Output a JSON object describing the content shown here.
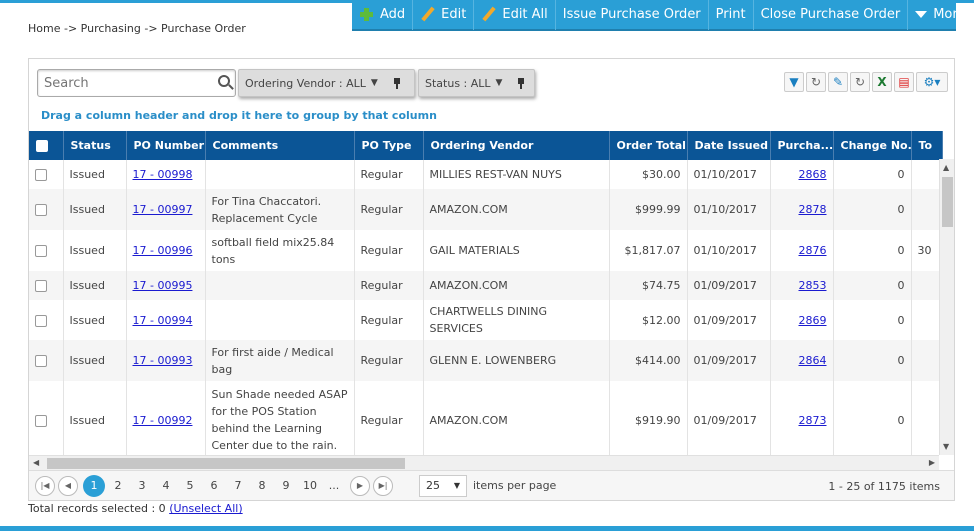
{
  "breadcrumb": "Home -> Purchasing -> Purchase Order",
  "toolbar": {
    "add": "Add",
    "edit": "Edit",
    "edit_all": "Edit All",
    "issue_po": "Issue Purchase Order",
    "print": "Print",
    "close_po": "Close Purchase Order",
    "more": "More"
  },
  "search": {
    "placeholder": "Search"
  },
  "filters": {
    "vendor": "Ordering Vendor : ALL",
    "status": "Status : ALL"
  },
  "group_hint": "Drag a column header and drop it here to group by that column",
  "columns": [
    "Status",
    "PO Number",
    "Comments",
    "PO Type",
    "Ordering Vendor",
    "Order Total",
    "Date Issued",
    "Purcha...",
    "Change No.",
    "To"
  ],
  "rows": [
    {
      "status": "Issued",
      "po": "17 - 00998",
      "comments": "",
      "type": "Regular",
      "vendor": "MILLIES REST-VAN NUYS",
      "total": "$30.00",
      "date": "01/10/2017",
      "req": "2868",
      "change": "0",
      "to": ""
    },
    {
      "status": "Issued",
      "po": "17 - 00997",
      "comments": "For Tina Chaccatori. Replacement Cycle",
      "type": "Regular",
      "vendor": "AMAZON.COM",
      "total": "$999.99",
      "date": "01/10/2017",
      "req": "2878",
      "change": "0",
      "to": ""
    },
    {
      "status": "Issued",
      "po": "17 - 00996",
      "comments": "softball field mix25.84 tons",
      "type": "Regular",
      "vendor": "GAIL MATERIALS",
      "total": "$1,817.07",
      "date": "01/10/2017",
      "req": "2876",
      "change": "0",
      "to": "30"
    },
    {
      "status": "Issued",
      "po": "17 - 00995",
      "comments": "",
      "type": "Regular",
      "vendor": "AMAZON.COM",
      "total": "$74.75",
      "date": "01/09/2017",
      "req": "2853",
      "change": "0",
      "to": ""
    },
    {
      "status": "Issued",
      "po": "17 - 00994",
      "comments": "",
      "type": "Regular",
      "vendor": "CHARTWELLS DINING SERVICES",
      "total": "$12.00",
      "date": "01/09/2017",
      "req": "2869",
      "change": "0",
      "to": ""
    },
    {
      "status": "Issued",
      "po": "17 - 00993",
      "comments": "For first aide / Medical bag",
      "type": "Regular",
      "vendor": "GLENN E. LOWENBERG",
      "total": "$414.00",
      "date": "01/09/2017",
      "req": "2864",
      "change": "0",
      "to": ""
    },
    {
      "status": "Issued",
      "po": "17 - 00992",
      "comments": "Sun Shade needed ASAP for the POS Station behind the Learning Center due to the rain.",
      "type": "Regular",
      "vendor": "AMAZON.COM",
      "total": "$919.90",
      "date": "01/09/2017",
      "req": "2873",
      "change": "0",
      "to": ""
    }
  ],
  "pager": {
    "pages": [
      "1",
      "2",
      "3",
      "4",
      "5",
      "6",
      "7",
      "8",
      "9",
      "10",
      "..."
    ],
    "active_page": "1",
    "per_page": "25",
    "per_page_label": "items per page",
    "info": "1 - 25 of 1175 items"
  },
  "total_selected": "Total records selected : 0",
  "unselect_all": "(Unselect All)",
  "colors": {
    "accent": "#2a9fd6",
    "header": "#0b5596",
    "link": "#1a1ad0"
  }
}
